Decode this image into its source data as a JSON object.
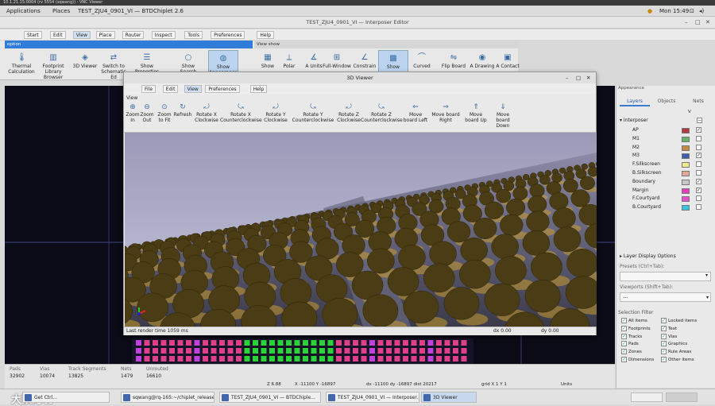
{
  "vnc_title": "10.1.21.15:0004 (rv 5554 (sqwang)) - VNC Viewer",
  "top_bar": {
    "applications": "Applications",
    "places": "Places",
    "window_label": "TEST_ZJU4_0901_VI — BTDChiplet 2.6",
    "clock": "Mon 15:49"
  },
  "editor_title": "TEST_ZJU4_0901_VI — Interposer Editor",
  "menubar": [
    "Start",
    "Edit",
    "View",
    "Place",
    "Router",
    "Inspect",
    "Tools",
    "Preferences",
    "Help"
  ],
  "ribbon": {
    "option_group": "option",
    "view_show_group": "View show",
    "buttons": [
      {
        "label": "Thermal Calculation",
        "icon": "thermometer-icon",
        "glyph": "🌡"
      },
      {
        "label": "Footprint Library Browser",
        "icon": "library-icon",
        "glyph": "▥"
      },
      {
        "label": "3D Viewer",
        "icon": "cube-icon",
        "glyph": "◈"
      },
      {
        "label": "Switch to Schematic Ed",
        "icon": "switch-icon",
        "glyph": "⇄"
      },
      {
        "label": "Show Properties",
        "icon": "properties-icon",
        "glyph": "☰"
      },
      {
        "label": "Show Search",
        "icon": "search-icon",
        "glyph": "○"
      },
      {
        "label": "Show Appearance",
        "icon": "appearance-icon",
        "glyph": "◍"
      },
      {
        "label": "Show",
        "icon": "grid-icon",
        "glyph": "▦"
      },
      {
        "label": "Polar",
        "icon": "polar-icon",
        "glyph": "⟂"
      },
      {
        "label": "A Units",
        "icon": "units-icon",
        "glyph": "∡"
      },
      {
        "label": "Full-Window",
        "icon": "fullwindow-icon",
        "glyph": "⊞"
      },
      {
        "label": "Constrain",
        "icon": "constrain-icon",
        "glyph": "∠"
      },
      {
        "label": "Show",
        "icon": "show-icon",
        "glyph": "▩"
      },
      {
        "label": "Curved",
        "icon": "curve-icon",
        "glyph": "⌒"
      },
      {
        "label": "Flip Board",
        "icon": "flip-icon",
        "glyph": "⇋"
      },
      {
        "label": "A Drawing",
        "icon": "drawing-icon",
        "glyph": "◉"
      },
      {
        "label": "A Contact",
        "icon": "contact-icon",
        "glyph": "▣"
      }
    ]
  },
  "viewer": {
    "title": "3D Viewer",
    "menu": [
      "File",
      "Edit",
      "View",
      "Preferences",
      "Help"
    ],
    "group": "View",
    "buttons": [
      {
        "label": "Zoom In",
        "icon": "zoom-in-icon",
        "glyph": "⊕"
      },
      {
        "label": "Zoom Out",
        "icon": "zoom-out-icon",
        "glyph": "⊖"
      },
      {
        "label": "Zoom to Fit",
        "icon": "zoom-fit-icon",
        "glyph": "⊙"
      },
      {
        "label": "Refresh",
        "icon": "refresh-icon",
        "glyph": "↻"
      },
      {
        "label": "Rotate X Clockwise",
        "icon": "rotate-x-cw-icon",
        "glyph": "⤾"
      },
      {
        "label": "Rotate X Counterclockwise",
        "icon": "rotate-x-ccw-icon",
        "glyph": "⤿"
      },
      {
        "label": "Rotate Y Clockwise",
        "icon": "rotate-y-cw-icon",
        "glyph": "⤾"
      },
      {
        "label": "Rotate Y Counterclockwise",
        "icon": "rotate-y-ccw-icon",
        "glyph": "⤿"
      },
      {
        "label": "Rotate Z Clockwise",
        "icon": "rotate-z-cw-icon",
        "glyph": "⤾"
      },
      {
        "label": "Rotate Z Counterclockwise",
        "icon": "rotate-z-ccw-icon",
        "glyph": "⤿"
      },
      {
        "label": "Move board Left",
        "icon": "move-left-icon",
        "glyph": "⇐"
      },
      {
        "label": "Move board Right",
        "icon": "move-right-icon",
        "glyph": "⇒"
      },
      {
        "label": "Move board Up",
        "icon": "move-up-icon",
        "glyph": "⇑"
      },
      {
        "label": "Move board Down",
        "icon": "move-down-icon",
        "glyph": "⇓"
      }
    ],
    "status": {
      "render": "Last render time 1059 ms",
      "dx": "dx 0.00",
      "dy": "dy 0.00"
    }
  },
  "appearance": {
    "title": "Appearance",
    "tabs": [
      "Layers",
      "Objects",
      "Nets"
    ],
    "group": "Interposer",
    "col_v": "V",
    "layers": [
      {
        "name": "AP",
        "color": "#b3393c",
        "checked": true
      },
      {
        "name": "M1",
        "color": "#67b56a",
        "checked": false
      },
      {
        "name": "M2",
        "color": "#c48a43",
        "checked": false
      },
      {
        "name": "M3",
        "color": "#3e5fa8",
        "checked": true
      },
      {
        "name": "F.Silkscreen",
        "color": "#f0ea88",
        "checked": false
      },
      {
        "name": "B.Silkscreen",
        "color": "#e4a898",
        "checked": false
      },
      {
        "name": "Boundary",
        "color": "#c9c9c9",
        "checked": true
      },
      {
        "name": "Margin",
        "color": "#e33fbf",
        "checked": true
      },
      {
        "name": "F.Courtyard",
        "color": "#e84cd0",
        "checked": false
      },
      {
        "name": "B.Courtyard",
        "color": "#36c5e0",
        "checked": false
      }
    ],
    "display_options": "Layer Display Options",
    "presets": "Presets (Ctrl+Tab):",
    "viewports": "Viewports (Shift+Tab):",
    "viewports_value": "---",
    "selection_filter": "Selection Filter",
    "filter_items": [
      "All items",
      "Locked items",
      "Footprints",
      "Text",
      "Tracks",
      "Vias",
      "Pads",
      "Graphics",
      "Zones",
      "Rule Areas",
      "Dimensions",
      "Other items"
    ]
  },
  "status": {
    "headers": [
      "Pads",
      "Vias",
      "Track Segments",
      "Nets",
      "Unrouted"
    ],
    "values": [
      "32902",
      "10074",
      "13825",
      "1479",
      "16610"
    ]
  },
  "coords": {
    "z": "Z 6.88",
    "xy": "X -11100  Y -16897",
    "dxdy": "dx -11100  dy -16897  dist 20217",
    "grid": "grid X 1  Y 1",
    "units": "Units"
  },
  "taskbar": [
    {
      "label": "Get Ctrl..."
    },
    {
      "label": "sqwang@rq-165:~/chiplet_release/b..."
    },
    {
      "label": "TEST_ZJU4_0901_VI — BTDChiple..."
    },
    {
      "label": "TEST_ZJU4_0901_VI — Interposer..."
    },
    {
      "label": "3D Viewer",
      "active": true
    }
  ],
  "watermark": "大数跨境"
}
